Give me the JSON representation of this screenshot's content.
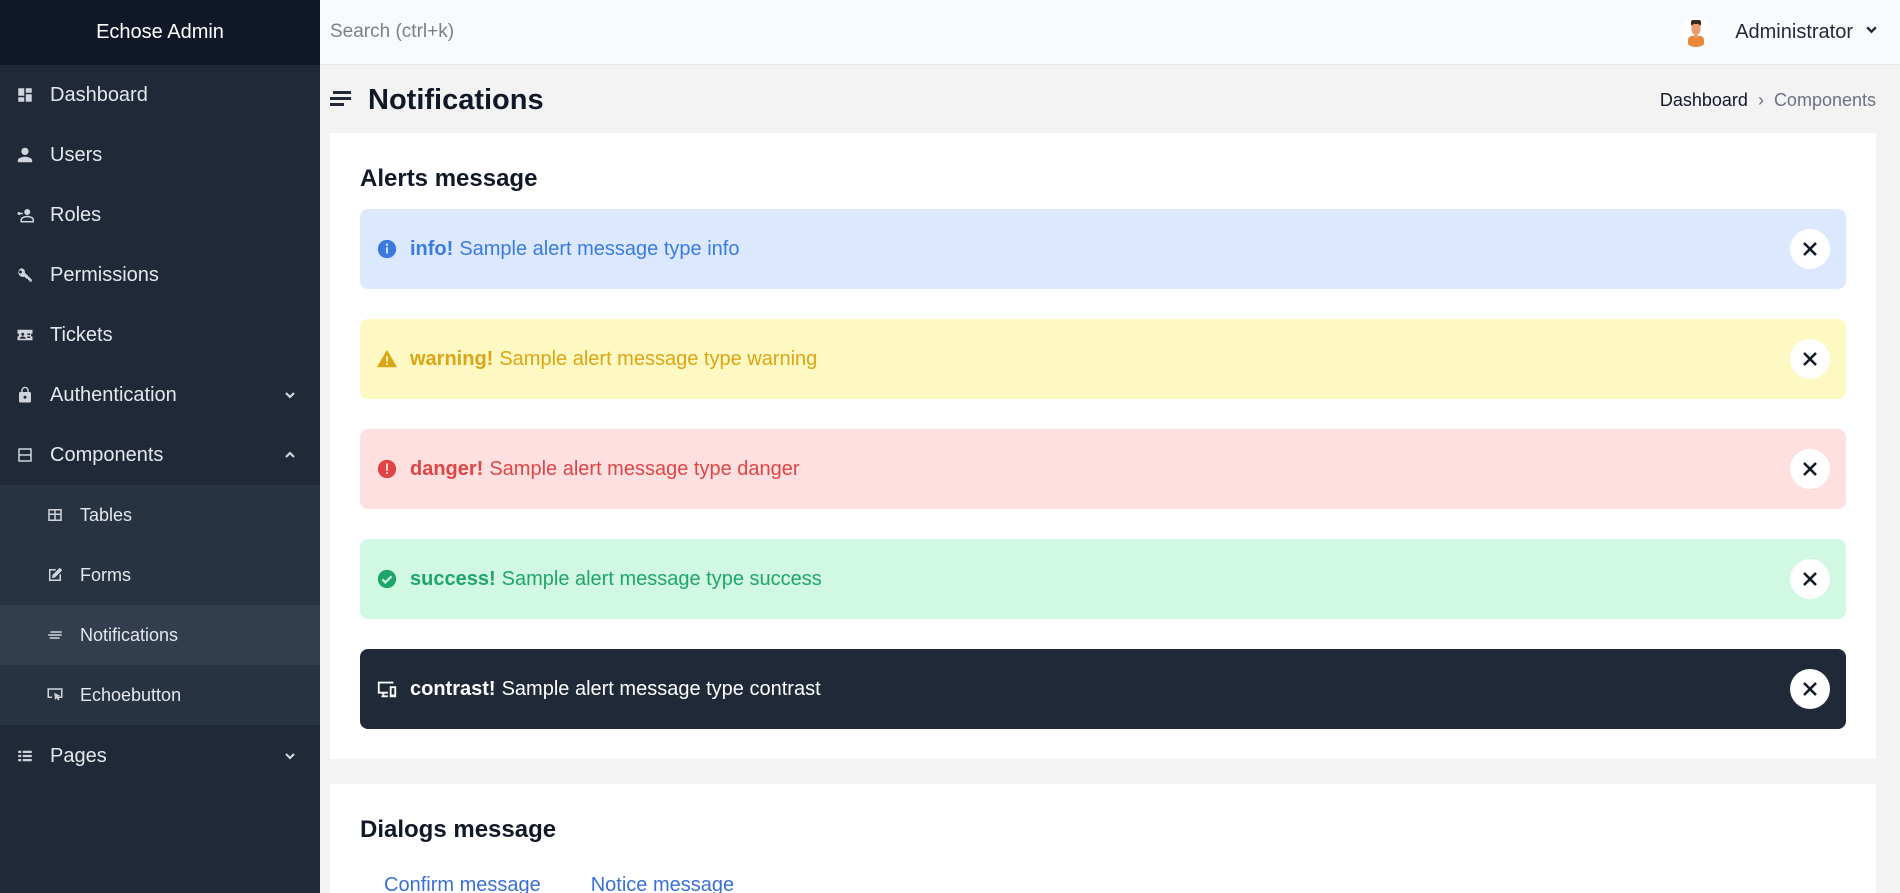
{
  "brand": {
    "name": "Echose Admin"
  },
  "sidebar": {
    "items": [
      {
        "label": "Dashboard",
        "icon": "dashboard-icon"
      },
      {
        "label": "Users",
        "icon": "user-icon"
      },
      {
        "label": "Roles",
        "icon": "roles-icon"
      },
      {
        "label": "Permissions",
        "icon": "key-icon"
      },
      {
        "label": "Tickets",
        "icon": "ticket-icon"
      },
      {
        "label": "Authentication",
        "icon": "lock-icon",
        "expandable": true,
        "expanded": false
      },
      {
        "label": "Components",
        "icon": "components-icon",
        "expandable": true,
        "expanded": true
      },
      {
        "label": "Pages",
        "icon": "list-icon",
        "expandable": true,
        "expanded": false
      }
    ],
    "components_children": [
      {
        "label": "Tables",
        "icon": "table-icon"
      },
      {
        "label": "Forms",
        "icon": "edit-icon"
      },
      {
        "label": "Notifications",
        "icon": "notes-icon",
        "active": true
      },
      {
        "label": "Echoebutton",
        "icon": "cursor-screen-icon"
      }
    ]
  },
  "topbar": {
    "search_placeholder": "Search (ctrl+k)",
    "user_name": "Administrator"
  },
  "page": {
    "title": "Notifications",
    "breadcrumb": {
      "link": "Dashboard",
      "separator": "›",
      "current": "Components"
    }
  },
  "alerts_card": {
    "title": "Alerts message",
    "alerts": [
      {
        "type": "info!",
        "message": "Sample alert message type info",
        "bg": "#dbe8fe",
        "color": "#3b7be0"
      },
      {
        "type": "warning!",
        "message": "Sample alert message type warning",
        "bg": "#fef8c3",
        "color": "#dba515"
      },
      {
        "type": "danger!",
        "message": "Sample alert message type danger",
        "bg": "#fee0e0",
        "color": "#e04545"
      },
      {
        "type": "success!",
        "message": "Sample alert message type success",
        "bg": "#d1f8e3",
        "color": "#1fa56a"
      },
      {
        "type": "contrast!",
        "message": "Sample alert message type contrast",
        "bg": "#1f2937",
        "color": "#ffffff"
      }
    ]
  },
  "dialogs_card": {
    "title": "Dialogs message",
    "links": [
      "Confirm message",
      "Notice message"
    ]
  },
  "colors": {
    "sidebar_bg": "#1f2937",
    "brand_bg": "#111827",
    "accent_link": "#3b6fd6"
  }
}
